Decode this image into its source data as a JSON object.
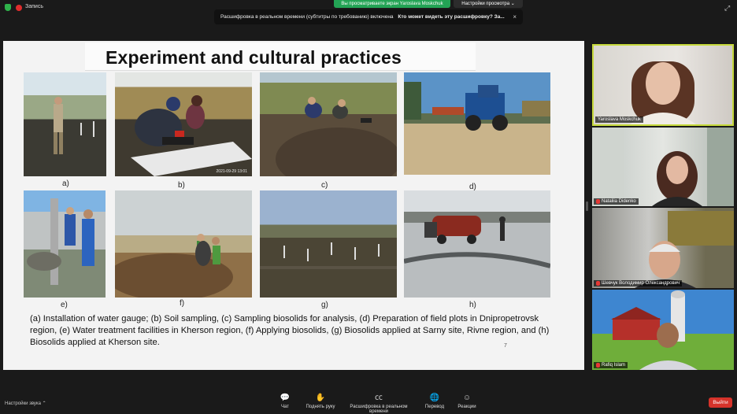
{
  "topbar": {
    "record_label": "Запись",
    "share_banner": "Вы просматриваете экран Yaroslava Moskchuk",
    "view_options": "Настройки просмотра ⌄",
    "fullscreen_icon": "expand-icon"
  },
  "caption_banner": {
    "text": "Расшифровка в реальном времени (субтитры по требованию) включена",
    "link": "Кто может видеть эту расшифровку? За...",
    "close": "×"
  },
  "slide": {
    "title": "Experiment and cultural practices",
    "labels": [
      "a)",
      "b)",
      "c)",
      "d)",
      "e)",
      "f)",
      "g)",
      "h)"
    ],
    "caption": "(a) Installation of water gauge; (b) Soil sampling, (c) Sampling biosolids for analysis, (d) Preparation of field plots in Dnipropetrovsk region, (e) Water treatment facilities in Kherson region, (f) Applying biosolids, (g) Biosolids applied at Sarny site, Rivne region, and (h) Biosolids applied at Kherson site.",
    "page_mark": "7",
    "photo_b_timestamp": "2021-09-29 13:01"
  },
  "participants": [
    {
      "name": "Yaroslava Moskchuk",
      "muted": false
    },
    {
      "name": "Nataliia Didenko",
      "muted": true
    },
    {
      "name": "Шевчук Володимир Олександрович",
      "muted": true
    },
    {
      "name": "Rafiq Islam",
      "muted": true
    }
  ],
  "toolbar": {
    "audio_settings": "Настройки звука ⌃",
    "chat": "Чат",
    "raise_hand": "Поднять руку",
    "transcript": "Расшифровка в реальном времени",
    "translate": "Перевод",
    "reactions": "Реакции",
    "leave": "Выйти"
  },
  "colors": {
    "share_green": "#23a455",
    "active_speaker": "#c6d93b",
    "leave_red": "#d6332a"
  }
}
